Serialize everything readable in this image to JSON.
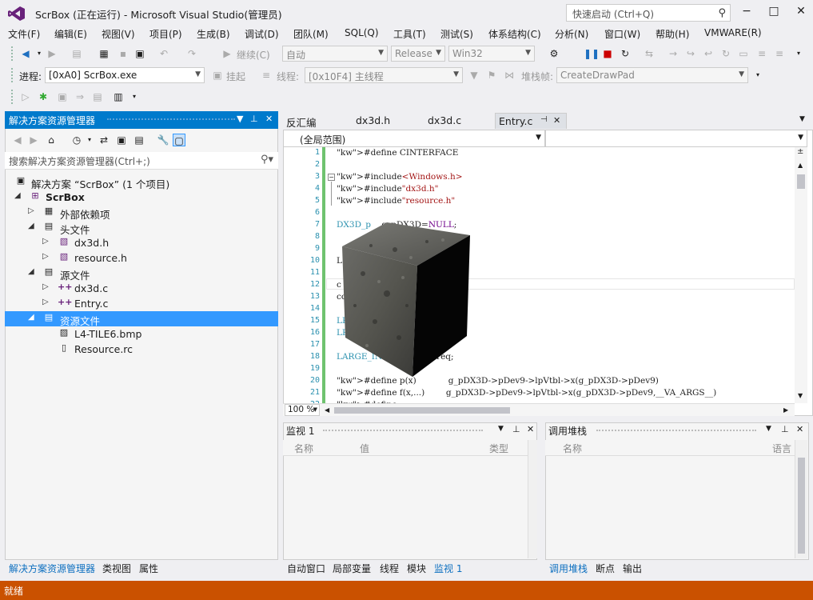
{
  "window": {
    "title": "ScrBox (正在运行) - Microsoft Visual Studio(管理员)",
    "quick_launch_placeholder": "快速启动 (Ctrl+Q)"
  },
  "menu": [
    "文件(F)",
    "编辑(E)",
    "视图(V)",
    "项目(P)",
    "生成(B)",
    "调试(D)",
    "团队(M)",
    "SQL(Q)",
    "工具(T)",
    "测试(S)",
    "体系结构(C)",
    "分析(N)",
    "窗口(W)",
    "帮助(H)",
    "VMWARE(R)"
  ],
  "toolbar1": {
    "continue_label": "继续(C)",
    "config_auto": "自动",
    "config_build": "Release",
    "platform": "Win32"
  },
  "toolbar2": {
    "process_label": "进程:",
    "process_value": "[0xA0] ScrBox.exe",
    "suspend_label": "挂起",
    "thread_label": "线程:",
    "thread_value": "[0x10F4] 主线程",
    "stack_label": "堆栈帧:",
    "stack_value": "CreateDrawPad"
  },
  "solution_explorer": {
    "title": "解决方案资源管理器",
    "search_placeholder": "搜索解决方案资源管理器(Ctrl+;)",
    "items": [
      {
        "label": "解决方案 “ScrBox” (1 个项目)",
        "icon": "solution-icon",
        "expander": ""
      },
      {
        "label": "ScrBox",
        "icon": "project-icon",
        "expander": "◢"
      },
      {
        "label": "外部依赖项",
        "icon": "external-deps-icon",
        "expander": "▷"
      },
      {
        "label": "头文件",
        "icon": "folder-icon",
        "expander": "◢"
      },
      {
        "label": "dx3d.h",
        "icon": "header-file-icon",
        "expander": "▷"
      },
      {
        "label": "resource.h",
        "icon": "header-file-icon",
        "expander": "▷"
      },
      {
        "label": "源文件",
        "icon": "folder-icon",
        "expander": "◢"
      },
      {
        "label": "dx3d.c",
        "icon": "c-file-icon",
        "expander": "▷"
      },
      {
        "label": "Entry.c",
        "icon": "c-file-icon",
        "expander": "▷"
      },
      {
        "label": "资源文件",
        "icon": "folder-icon",
        "expander": "◢"
      },
      {
        "label": "L4-TILE6.bmp",
        "icon": "bitmap-file-icon",
        "expander": ""
      },
      {
        "label": "Resource.rc",
        "icon": "resource-file-icon",
        "expander": ""
      }
    ],
    "bottom_tabs": [
      "解决方案资源管理器",
      "类视图",
      "属性"
    ]
  },
  "editor": {
    "tabs": [
      "反汇编",
      "dx3d.h",
      "dx3d.c",
      "Entry.c"
    ],
    "scope": "(全局范围)",
    "zoom": "100 %",
    "lines": [
      {
        "n": "1",
        "text": "#define CINTERFACE"
      },
      {
        "n": "2",
        "text": ""
      },
      {
        "n": "3",
        "text": "#include<Windows.h>"
      },
      {
        "n": "4",
        "text": "#include\"dx3d.h\""
      },
      {
        "n": "5",
        "text": "#include\"resource.h\""
      },
      {
        "n": "6",
        "text": ""
      },
      {
        "n": "7",
        "text": "DX3D_p    g_pDX3D=NULL;"
      },
      {
        "n": "8",
        "text": ""
      },
      {
        "n": "9",
        "text": ""
      },
      {
        "n": "10",
        "text": "L"
      },
      {
        "n": "11",
        "text": ""
      },
      {
        "n": "12",
        "text": "c                       ;"
      },
      {
        "n": "13",
        "text": "co                      0;"
      },
      {
        "n": "14",
        "text": ""
      },
      {
        "n": "15",
        "text": "LPDI              ex=NULL;"
      },
      {
        "n": "16",
        "text": "LPD3DXME          ULL;"
      },
      {
        "n": "17",
        "text": ""
      },
      {
        "n": "18",
        "text": "LARGE_INTEGER g_liFreq;"
      },
      {
        "n": "19",
        "text": ""
      },
      {
        "n": "20",
        "text": "#define p(x)            g_pDX3D->pDev9->lpVtbl->x(g_pDX3D->pDev9)"
      },
      {
        "n": "21",
        "text": "#define f(x,...)        g_pDX3D->pDev9->lpVtbl->x(g_pDX3D->pDev9,__VA_ARGS__)"
      },
      {
        "n": "22",
        "text": "#define  ..."
      }
    ]
  },
  "watch_panel": {
    "title": "监视 1",
    "columns": [
      "名称",
      "值",
      "类型"
    ],
    "tabs": [
      "自动窗口",
      "局部变量",
      "线程",
      "模块",
      "监视 1"
    ]
  },
  "callstack_panel": {
    "title": "调用堆栈",
    "columns": [
      "名称",
      "语言"
    ],
    "tabs": [
      "调用堆栈",
      "断点",
      "输出"
    ]
  },
  "status": "就绪",
  "colors": {
    "accent": "#007acc",
    "status_debug": "#ca5100",
    "selection": "#3399ff"
  }
}
